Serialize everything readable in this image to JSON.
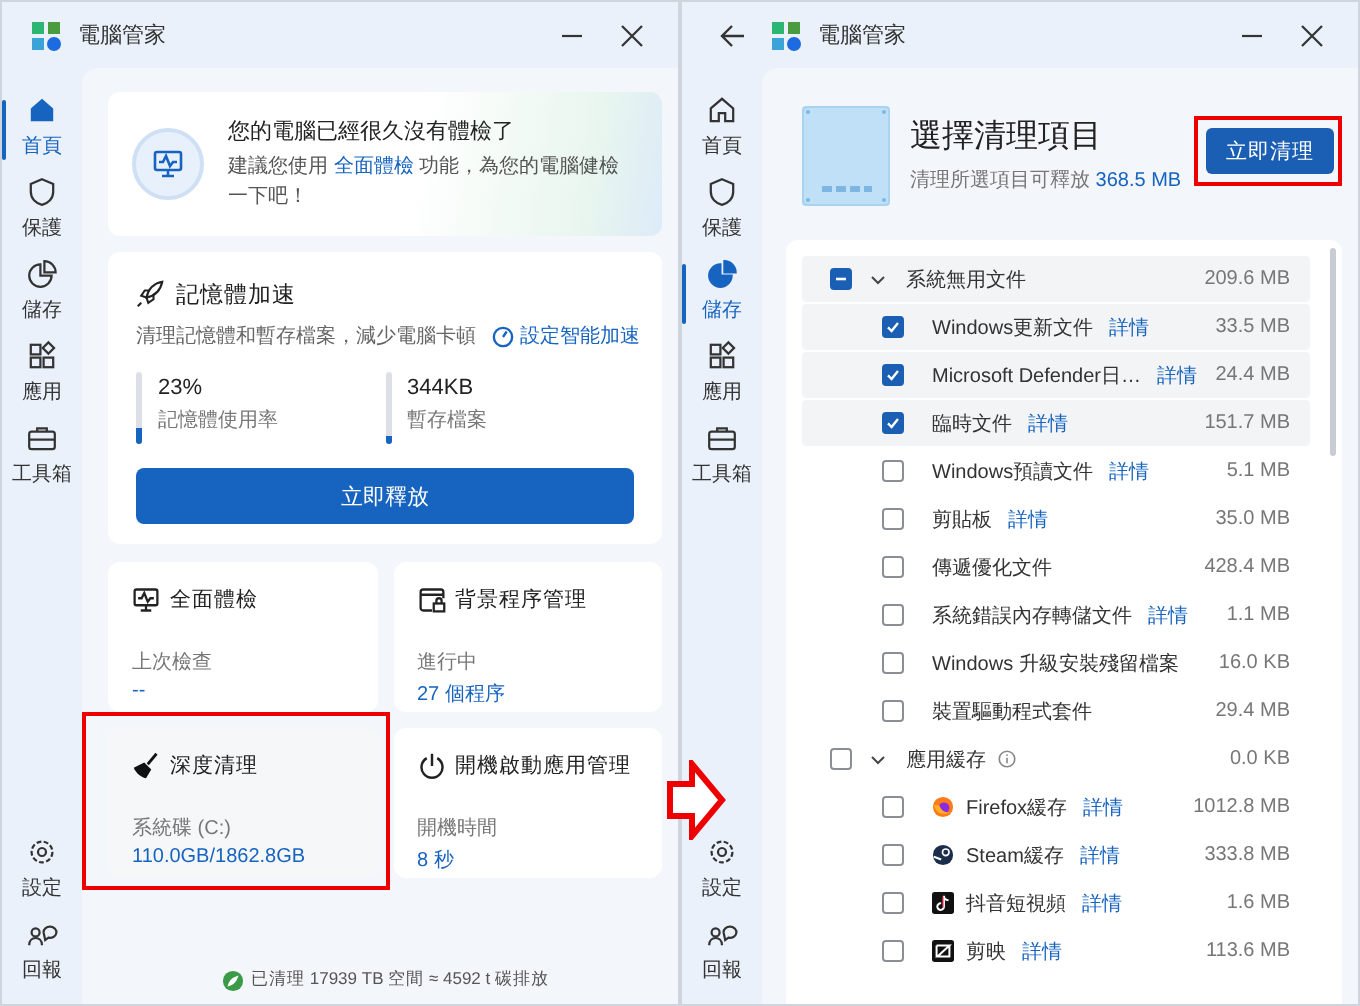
{
  "home_window": {
    "title": "電腦管家",
    "nav": [
      {
        "label": "首頁",
        "selected": true
      },
      {
        "label": "保護",
        "selected": false
      },
      {
        "label": "儲存",
        "selected": false
      },
      {
        "label": "應用",
        "selected": false
      },
      {
        "label": "工具箱",
        "selected": false
      }
    ],
    "nav_bottom": [
      {
        "label": "設定"
      },
      {
        "label": "回報"
      }
    ],
    "banner": {
      "title": "您的電腦已經很久沒有體檢了",
      "text_before": "建議您使用 ",
      "link": "全面體檢",
      "text_after": " 功能，為您的電腦健檢一下吧！"
    },
    "memory": {
      "title": "記憶體加速",
      "description": "清理記憶體和暫存檔案，減少電腦卡頓",
      "link": "設定智能加速",
      "button": "立即釋放",
      "meters": [
        {
          "value": "23%",
          "label": "記憶體使用率",
          "level": 0.23
        },
        {
          "value": "344KB",
          "label": "暫存檔案",
          "level": 0.12
        }
      ]
    },
    "tiles": [
      {
        "title": "全面體檢",
        "label": "上次檢查",
        "value": "--",
        "highlighted": false
      },
      {
        "title": "背景程序管理",
        "label": "進行中",
        "value": "27 個程序",
        "highlighted": false
      },
      {
        "title": "深度清理",
        "label": "系統碟 (C:)",
        "value": "110.0GB/1862.8GB",
        "highlighted": true
      },
      {
        "title": "開機啟動應用管理",
        "label": "開機時間",
        "value": "8 秒",
        "highlighted": false
      }
    ],
    "footer": "已清理 17939 TB 空間 ≈ 4592 t 碳排放"
  },
  "cleanup_window": {
    "title": "電腦管家",
    "back_button": true,
    "nav": [
      {
        "label": "首頁",
        "selected": false
      },
      {
        "label": "保護",
        "selected": false
      },
      {
        "label": "儲存",
        "selected": true
      },
      {
        "label": "應用",
        "selected": false
      },
      {
        "label": "工具箱",
        "selected": false
      }
    ],
    "nav_bottom": [
      {
        "label": "設定"
      },
      {
        "label": "回報"
      }
    ],
    "header": {
      "title": "選擇清理項目",
      "subtitle": "清理所選項目可釋放",
      "amount": "368.5 MB",
      "button": "立即清理",
      "button_highlighted": true
    },
    "groups": [
      {
        "name": "系統無用文件",
        "size": "209.6 MB",
        "checked": true,
        "partial": true,
        "expanded": true,
        "items": [
          {
            "kind": "file",
            "name": "Windows更新文件",
            "link": "詳情",
            "size": "33.5 MB",
            "checked": true
          },
          {
            "kind": "file",
            "name": "Microsoft Defender日…",
            "link": "詳情",
            "size": "24.4 MB",
            "checked": true
          },
          {
            "kind": "file",
            "name": "臨時文件",
            "link": "詳情",
            "size": "151.7 MB",
            "checked": true
          },
          {
            "kind": "file",
            "name": "Windows預讀文件",
            "link": "詳情",
            "size": "5.1 MB",
            "checked": false
          },
          {
            "kind": "file",
            "name": "剪貼板",
            "link": "詳情",
            "size": "35.0 MB",
            "checked": false
          },
          {
            "kind": "file",
            "name": "傳遞優化文件",
            "size": "428.4 MB",
            "checked": false
          },
          {
            "kind": "file",
            "name": "系統錯誤內存轉儲文件",
            "link": "詳情",
            "size": "1.1 MB",
            "checked": false
          },
          {
            "kind": "file",
            "name": "Windows 升級安裝殘留檔案",
            "size": "16.0 KB",
            "checked": false
          },
          {
            "kind": "file",
            "name": "裝置驅動程式套件",
            "size": "29.4 MB",
            "checked": false
          }
        ]
      },
      {
        "name": "應用緩存",
        "size": "0.0 KB",
        "checked": false,
        "expanded": true,
        "info": true,
        "items": [
          {
            "kind": "app",
            "name": "Firefox緩存",
            "link": "詳情",
            "size": "1012.8 MB",
            "checked": false
          },
          {
            "kind": "app",
            "name": "Steam緩存",
            "link": "詳情",
            "size": "333.8 MB",
            "checked": false
          },
          {
            "kind": "app",
            "name": "抖音短視頻",
            "link": "詳情",
            "size": "1.6 MB",
            "checked": false
          },
          {
            "kind": "app",
            "name": "剪映",
            "link": "詳情",
            "size": "113.6 MB",
            "checked": false
          }
        ]
      }
    ]
  },
  "callout_arrow": true
}
